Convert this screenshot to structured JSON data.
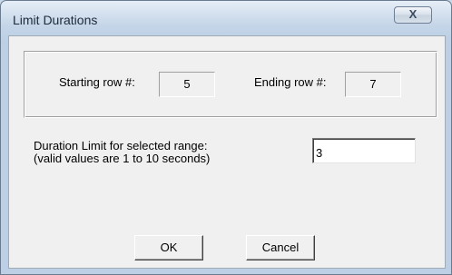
{
  "window": {
    "title": "Limit Durations",
    "close_glyph": "X"
  },
  "range": {
    "start_label": "Starting row #:",
    "start_value": "5",
    "end_label": "Ending row #:",
    "end_value": "7"
  },
  "duration": {
    "label_line1": "Duration Limit for selected range:",
    "label_line2": "(valid values are 1 to 10 seconds)",
    "value": "3"
  },
  "buttons": {
    "ok_label": "OK",
    "cancel_label": "Cancel"
  }
}
